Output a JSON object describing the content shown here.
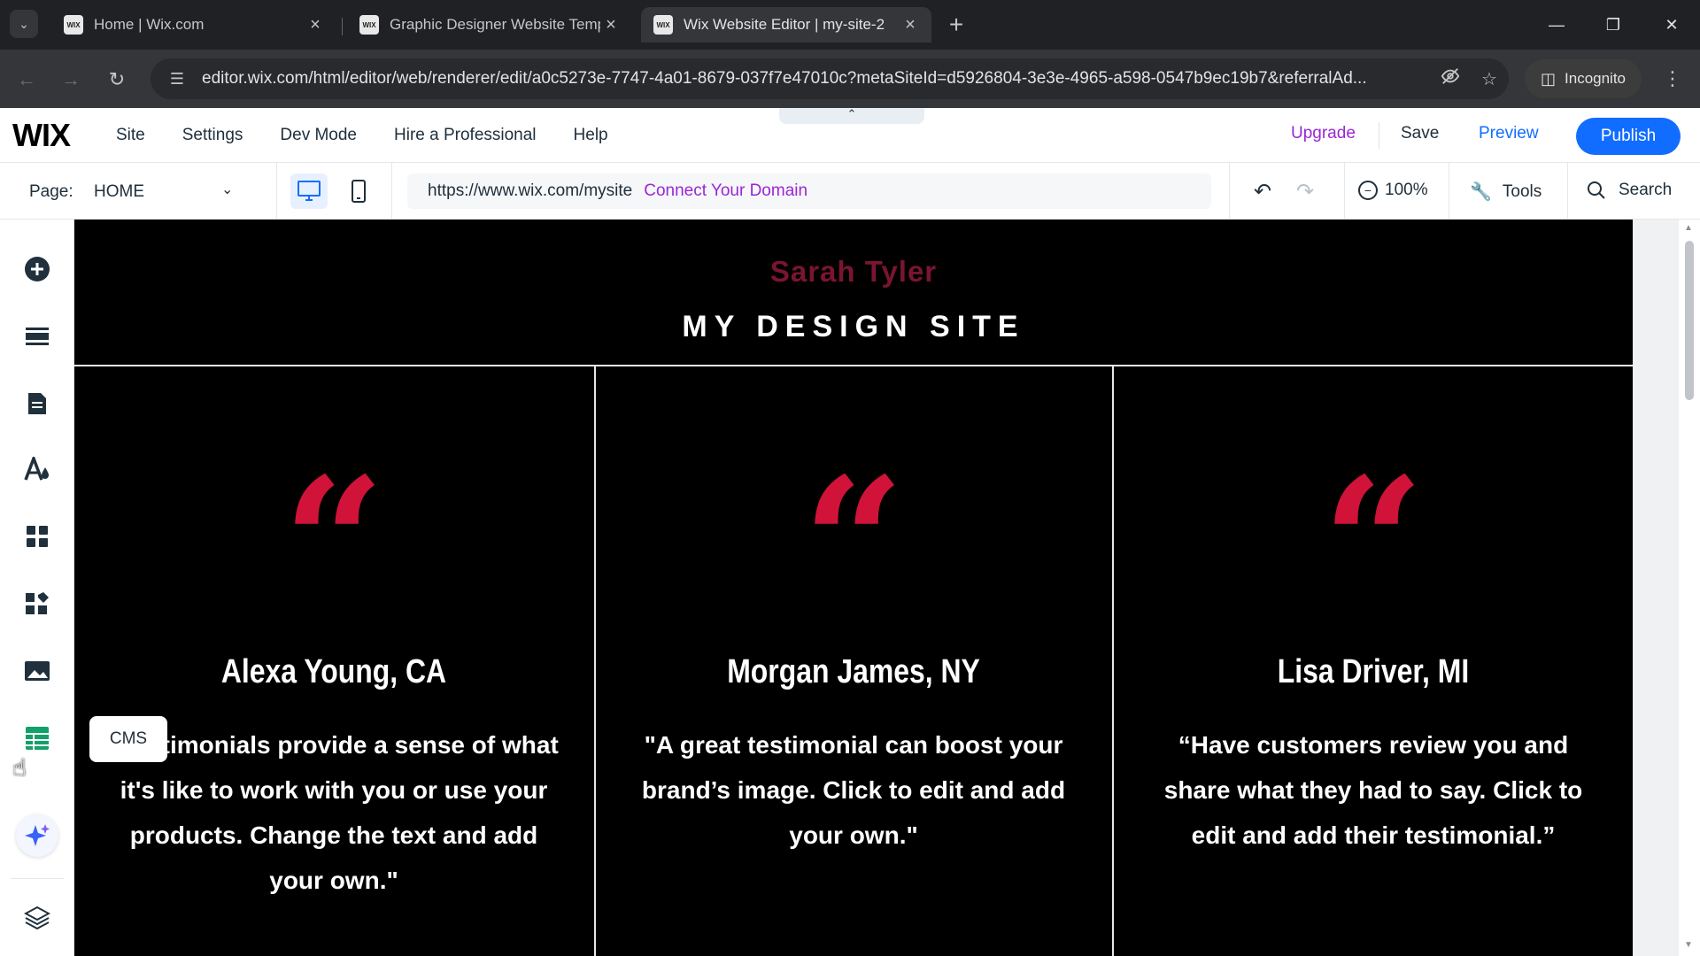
{
  "browser": {
    "tabs": [
      {
        "title": "Home | Wix.com",
        "favicon": "WIX"
      },
      {
        "title": "Graphic Designer Website Temp",
        "favicon": "WIX"
      },
      {
        "title": "Wix Website Editor | my-site-2",
        "favicon": "WIX"
      }
    ],
    "url": "editor.wix.com/html/editor/web/renderer/edit/a0c5273e-7747-4a01-8679-037f7e47010c?metaSiteId=d5926804-3e3e-4965-a598-0547b9ec19b7&referralAd...",
    "incognito_label": "Incognito"
  },
  "wix": {
    "logo": "WIX",
    "menu": [
      "Site",
      "Settings",
      "Dev Mode",
      "Hire a Professional",
      "Help"
    ],
    "upgrade": "Upgrade",
    "save": "Save",
    "preview": "Preview",
    "publish": "Publish",
    "page_label": "Page:",
    "page_value": "HOME",
    "site_url": "https://www.wix.com/mysite",
    "connect_domain": "Connect Your Domain",
    "zoom": "100%",
    "tools": "Tools",
    "search": "Search",
    "cms_tooltip": "CMS"
  },
  "site": {
    "name": "Sarah Tyler",
    "title": "MY DESIGN SITE",
    "quote_mark": "“",
    "testimonials": [
      {
        "name": "Alexa Young, CA",
        "text": "\"Testimonials provide a sense of what it's like to work with you or use your products. Change the text and add your own.\""
      },
      {
        "name": "Morgan James, NY",
        "text": "\"A great testimonial can boost your brand’s image. Click to edit and add your own.\""
      },
      {
        "name": "Lisa Driver, MI",
        "text": "“Have customers review you and share what they had to say. Click to edit and add their testimonial.”"
      }
    ]
  },
  "colors": {
    "accent_blue": "#116dff",
    "upgrade_purple": "#9a27d5",
    "quote_red": "#d11339",
    "site_name_maroon": "#7a1530"
  }
}
